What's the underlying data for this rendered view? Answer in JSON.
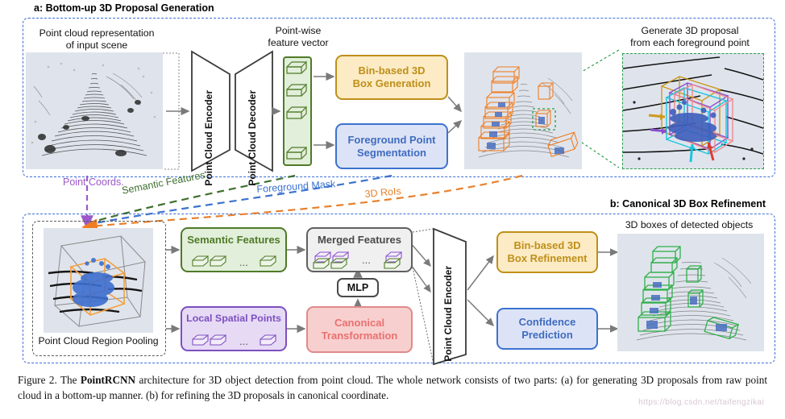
{
  "sections": {
    "a_title": "a: Bottom-up 3D Proposal Generation",
    "b_title": "b: Canonical 3D Box Refinement"
  },
  "panel_a": {
    "input_scene_label": "Point cloud representation\nof input scene",
    "pointwise_label": "Point-wise\nfeature vector",
    "encoder_label": "Point Cloud\nEncoder",
    "decoder_label": "Point Cloud\nDecoder",
    "bin_box_generation": "Bin-based 3D\nBox Generation",
    "foreground_segmentation": "Foreground Point\nSegmentation",
    "zoom_label": "Generate 3D proposal\nfrom each foreground point"
  },
  "connectors": [
    {
      "label": "Point Coords.",
      "color": "#9b59c9"
    },
    {
      "label": "Semantic Features",
      "color": "#3f7030"
    },
    {
      "label": "Foreground Mask",
      "color": "#3c73cf"
    },
    {
      "label": "3D RoIs",
      "color": "#e8802c"
    }
  ],
  "panel_b": {
    "region_pooling_label": "Point Cloud Region Pooling",
    "semantic_features": "Semantic Features",
    "merged_features": "Merged Features",
    "local_spatial_points": "Local Spatial Points",
    "canonical_transformation": "Canonical\nTransformation",
    "mlp": "MLP",
    "encoder_label": "Point Cloud\nEncoder",
    "bin_box_refinement": "Bin-based 3D\nBox Refinement",
    "confidence_prediction": "Confidence\nPrediction",
    "output_label": "3D boxes of detected objects",
    "ellipsis": "..."
  },
  "colors": {
    "panel_border": "#3a6fd8",
    "gold": "#bf8f19",
    "gold_fill": "#fcebc4",
    "blue": "#3c73cf",
    "blue_fill": "#dde3f6",
    "green": "#4f7a28",
    "green_fill": "#e2efda",
    "purple": "#7d4fc0",
    "purple_fill": "#e6daf5",
    "pink": "#e8716f",
    "pink_fill": "#f8cfcf",
    "grey_fill": "#f0f0f0",
    "proposal_orange": "#f07d22",
    "detected_green": "#2fb04a",
    "scene_bg": "#dfe4ec"
  },
  "caption": {
    "line1_pre": "Figure 2. The ",
    "bold": "PointRCNN",
    "line1_post": " architecture for 3D object detection from point cloud.  The whole network consists of two parts: (a) for generating 3D proposals from raw point cloud in a bottom-up manner. (b) for refining the 3D proposals in canonical coordinate.",
    "watermark": "https://blog.csdn.net/taifengzikai"
  }
}
